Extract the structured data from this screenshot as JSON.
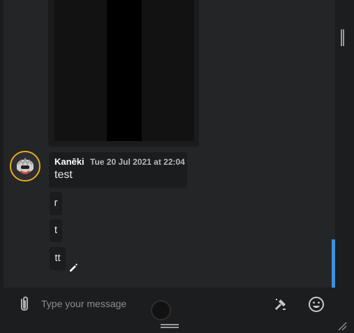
{
  "message_group": {
    "author": "Kanēki",
    "timestamp": "Tue 20 Jul 2021 at 22:04",
    "first_message": "test",
    "followup_messages": [
      "r",
      "t",
      "tt"
    ]
  },
  "composer": {
    "placeholder": "Type your message"
  },
  "icons": {
    "attach": "paperclip-icon",
    "sticker": "sticker-icon",
    "emoji": "emoji-icon",
    "edit": "pencil-icon",
    "resize": "resize-handle-icon"
  },
  "colors": {
    "accent_blue": "#3d8fdc",
    "avatar_ring": "#e8b01d"
  }
}
